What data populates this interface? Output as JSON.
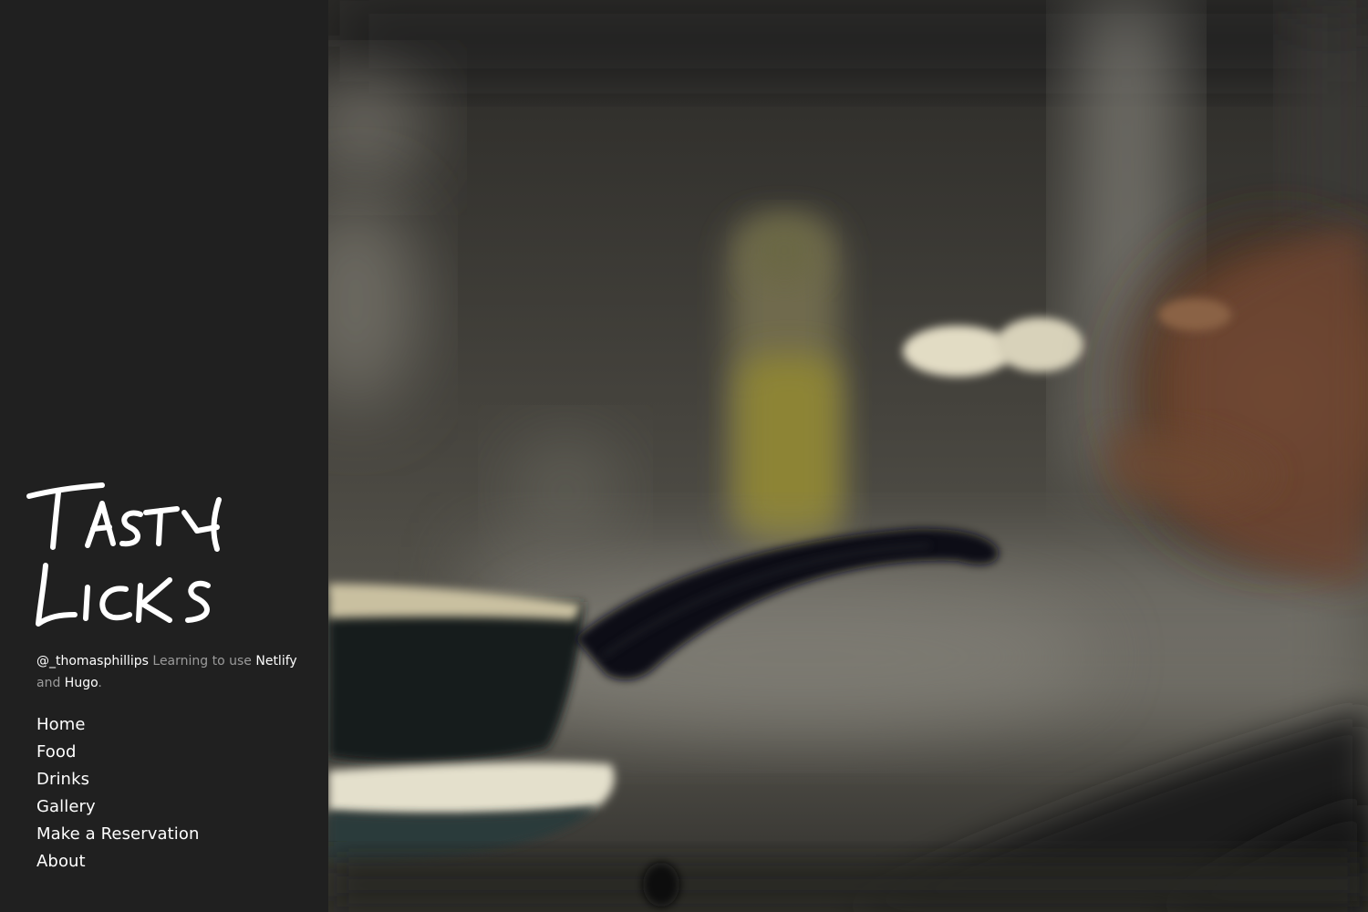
{
  "site": {
    "logo_text": "Tasty Licks",
    "logo_line1": "Tasty",
    "logo_line2": "Licks"
  },
  "tagline": {
    "handle": "@_thomasphillips",
    "text1": " Learning to use ",
    "link1": "Netlify",
    "text2": " and ",
    "link2": "Hugo",
    "text3": "."
  },
  "nav": {
    "items": [
      {
        "label": "Home"
      },
      {
        "label": "Food"
      },
      {
        "label": "Drinks"
      },
      {
        "label": "Gallery"
      },
      {
        "label": "Make a Reservation"
      },
      {
        "label": "About"
      }
    ]
  },
  "colors": {
    "sidebar_bg": "#202020",
    "link": "#ffffff",
    "muted_text": "#9b9b9b"
  },
  "hero": {
    "image_name": "blurred-kitchen-pan-photo"
  }
}
